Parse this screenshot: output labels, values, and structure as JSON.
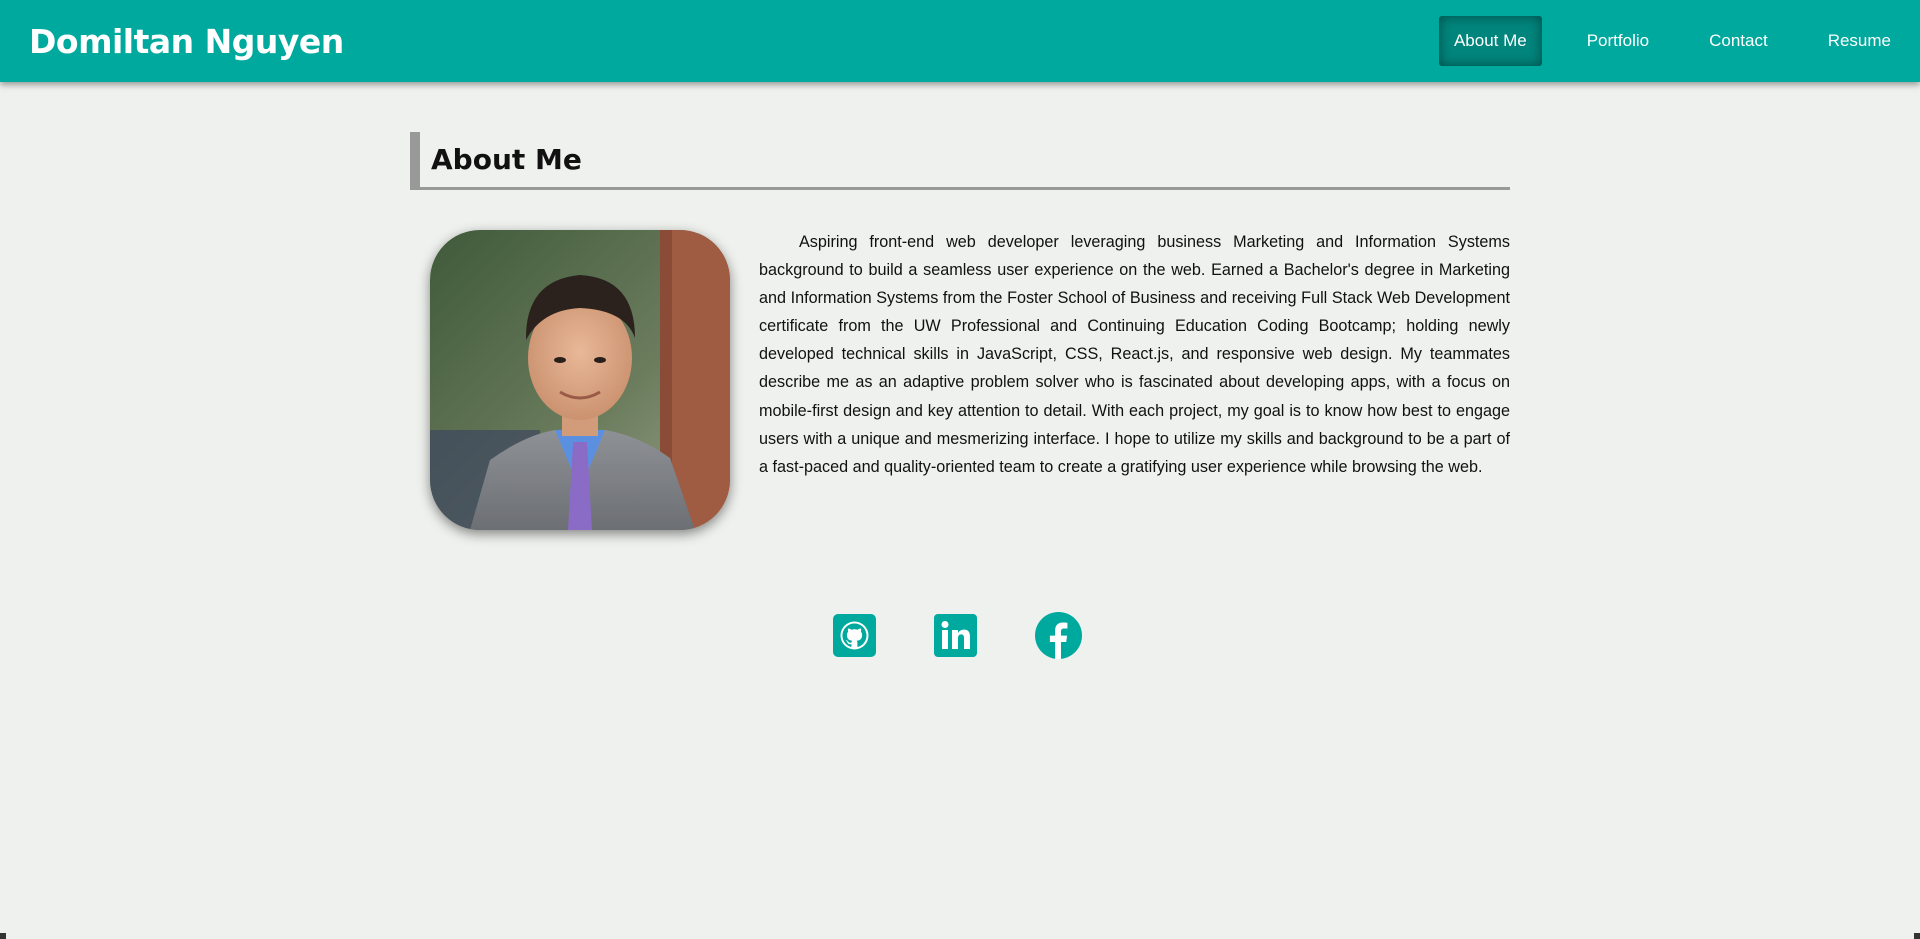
{
  "header": {
    "brand": "Domiltan Nguyen",
    "nav": [
      {
        "label": "About Me",
        "active": true
      },
      {
        "label": "Portfolio",
        "active": false
      },
      {
        "label": "Contact",
        "active": false
      },
      {
        "label": "Resume",
        "active": false
      }
    ]
  },
  "about": {
    "title": "About Me",
    "photo_alt": "portrait photo",
    "bio": "Aspiring front-end web developer leveraging business Marketing and Information Systems background to build a seamless user experience on the web. Earned a Bachelor's degree in Marketing and Information Systems from the Foster School of Business and receiving Full Stack Web Development certificate from the UW Professional and Continuing Education Coding Bootcamp; holding newly developed technical skills in JavaScript, CSS, React.js, and responsive web design. My teammates describe me as an adaptive problem solver who is fascinated about developing apps, with a focus on mobile-first design and key attention to detail. With each project, my goal is to know how best to engage users with a unique and mesmerizing interface. I hope to utilize my skills and background to be a part of a fast-paced and quality-oriented team to create a gratifying user experience while browsing the web."
  },
  "socials": [
    {
      "icon": "github-icon"
    },
    {
      "icon": "linkedin-icon"
    },
    {
      "icon": "facebook-icon"
    }
  ],
  "colors": {
    "primary": "#00a99d",
    "active_nav": "#00857c",
    "background": "#eff1ee",
    "divider": "#999999"
  }
}
